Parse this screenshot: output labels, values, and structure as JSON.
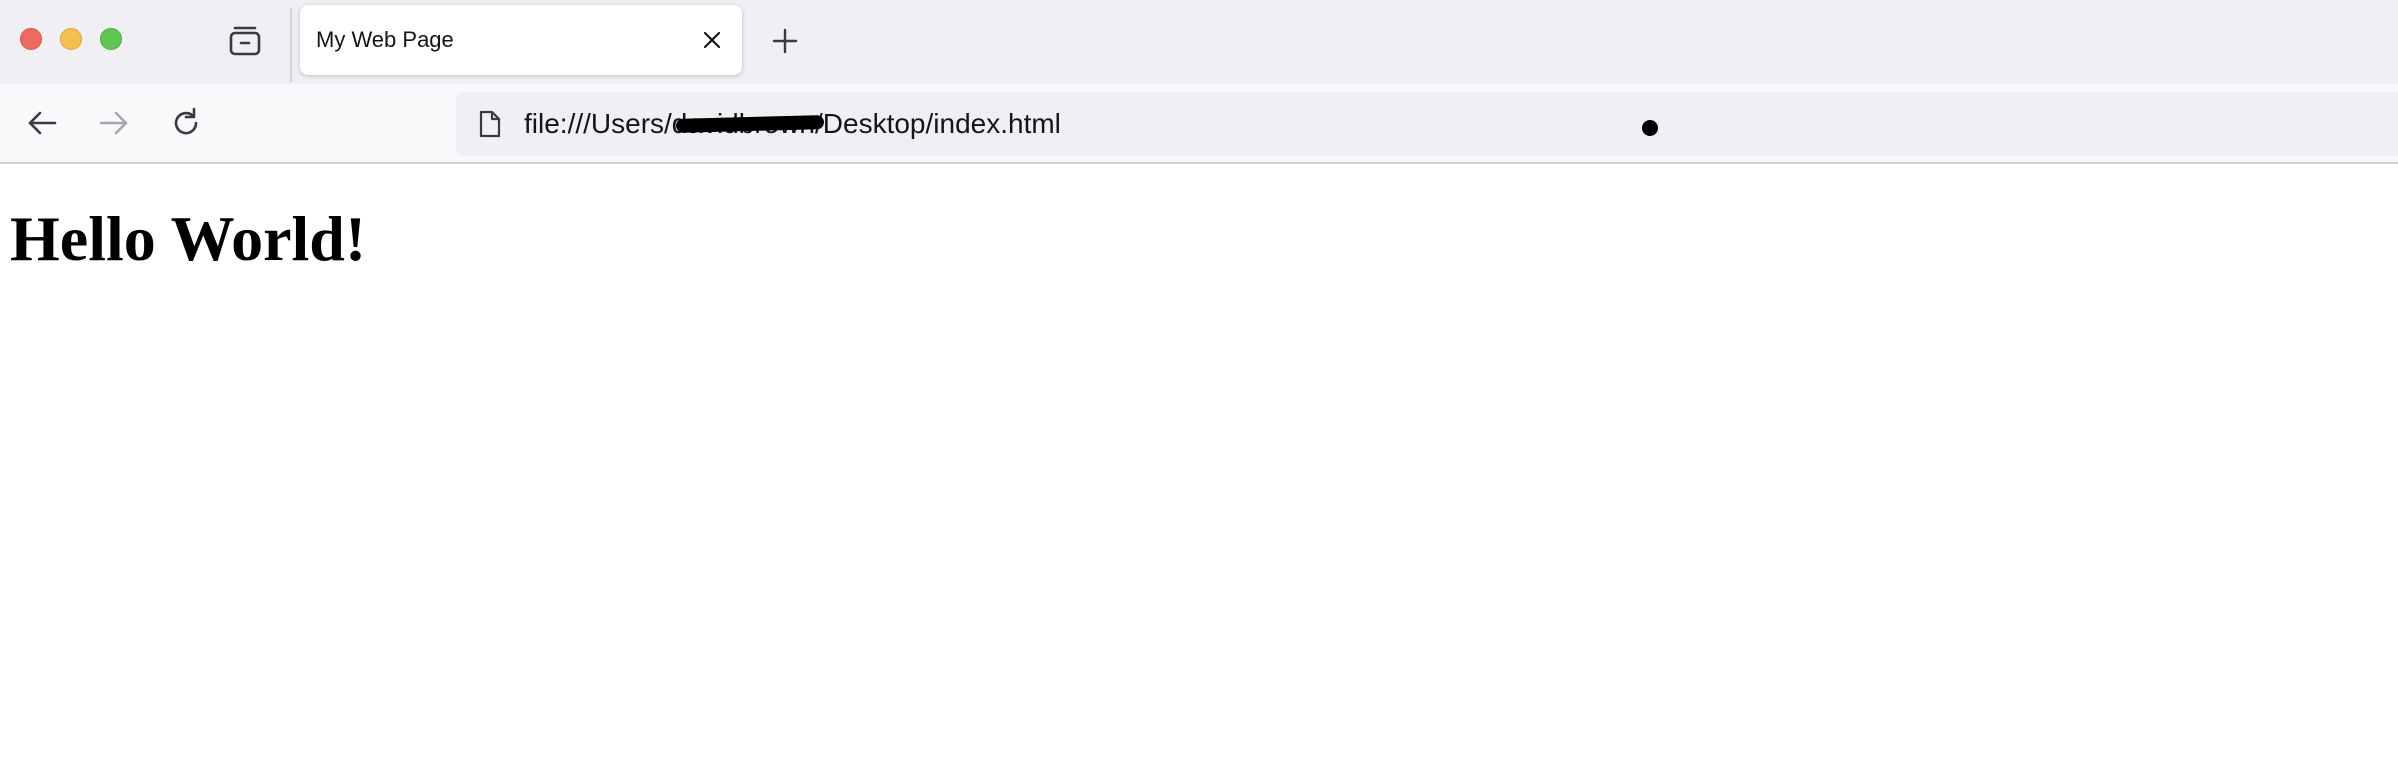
{
  "browser": {
    "tab": {
      "title": "My Web Page"
    },
    "urlbar": {
      "url": "file:///Users/davidbrown/Desktop/index.html"
    },
    "icons": {
      "tabs_overview": "tab-overview-icon",
      "close_tab": "close-icon",
      "new_tab": "plus-icon",
      "back": "arrow-left-icon",
      "forward": "arrow-right-icon",
      "reload": "reload-icon",
      "page": "page-icon"
    }
  },
  "page": {
    "heading": "Hello World!"
  },
  "colors": {
    "close": "#ec6a5e",
    "minimize": "#f4bf4f",
    "maximize": "#61c554",
    "tabstrip": "#f0eff4",
    "urlbar": "#f0f0f4"
  }
}
